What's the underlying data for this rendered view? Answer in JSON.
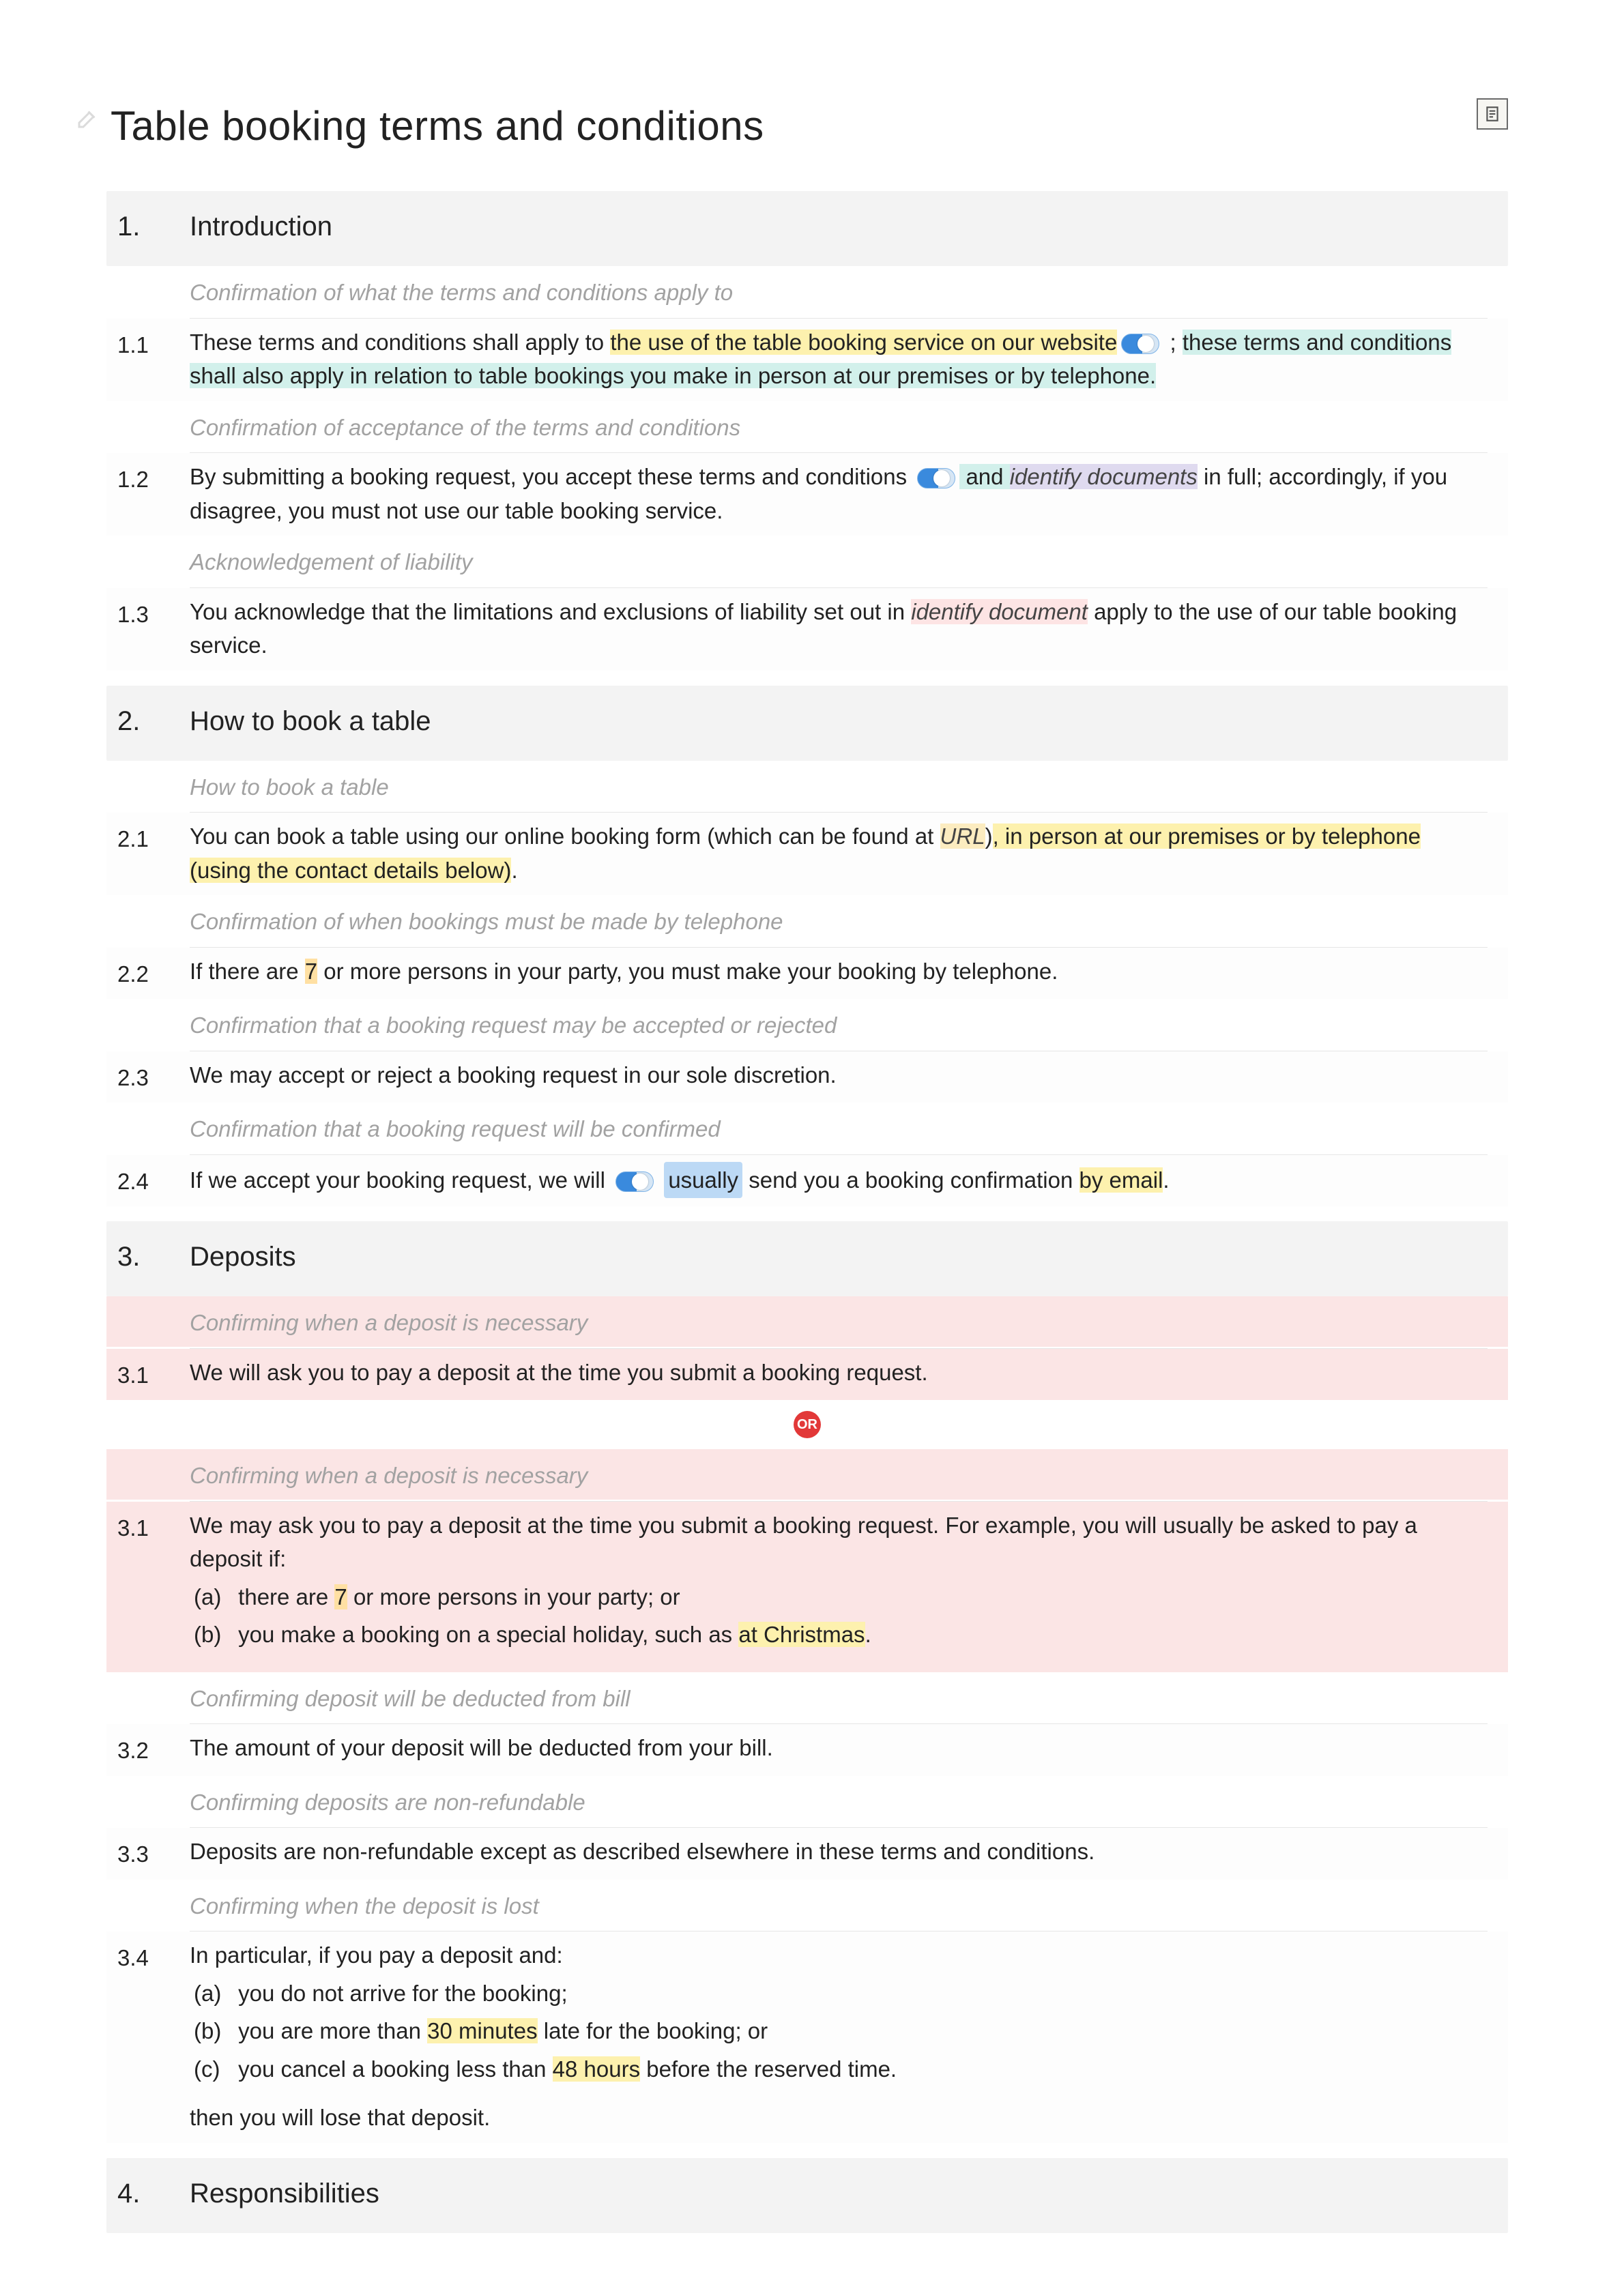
{
  "title": "Table booking terms and conditions",
  "sections": {
    "s1": {
      "num": "1.",
      "title": "Introduction"
    },
    "s2": {
      "num": "2.",
      "title": "How to book a table"
    },
    "s3": {
      "num": "3.",
      "title": "Deposits"
    },
    "s4": {
      "num": "4.",
      "title": "Responsibilities"
    }
  },
  "annots": {
    "a11": "Confirmation of what the terms and conditions apply to",
    "a12": "Confirmation of acceptance of the terms and conditions",
    "a13": "Acknowledgement of liability",
    "a21": "How to book a table",
    "a22": "Confirmation of when bookings must be made by telephone",
    "a23": "Confirmation that a booking request may be accepted or rejected",
    "a24": "Confirmation that a booking request will be confirmed",
    "a31a": "Confirming when a deposit is necessary",
    "a31b": "Confirming when a deposit is necessary",
    "a32": "Confirming deposit will be deducted from bill",
    "a33": "Confirming deposits are non-refundable",
    "a34": "Confirming when the deposit is lost"
  },
  "clauses": {
    "c11": {
      "num": "1.1",
      "pre": "These terms and conditions shall apply to ",
      "hl1": "the use of the table booking service on our website",
      "semi": " ; ",
      "hl2": "these terms and conditions shall also apply in relation to table bookings you make in person at our premises or by telephone."
    },
    "c12": {
      "num": "1.2",
      "pre": "By submitting a booking request, you accept these terms and conditions ",
      "and": " and ",
      "ph": "identify documents",
      "post": " in full; accordingly, if you disagree, you must not use our table booking service."
    },
    "c13": {
      "num": "1.3",
      "pre": "You acknowledge that the limitations and exclusions of liability set out in ",
      "ph": "identify document",
      "post": " apply to the use of our table booking service."
    },
    "c21": {
      "num": "2.1",
      "pre": "You can book a table using our online booking form (which can be found at ",
      "url": "URL",
      "close": ")",
      "hl1": ", in person at our premises or by telephone (using the contact details below)",
      "dot": "."
    },
    "c22": {
      "num": "2.2",
      "pre": "If there are ",
      "n": "7",
      "post": " or more persons in your party, you must make your booking by telephone."
    },
    "c23": {
      "num": "2.3",
      "text": "We may accept or reject a booking request in our sole discretion."
    },
    "c24": {
      "num": "2.4",
      "pre": "If we accept your booking request, we will ",
      "usually": "usually",
      "mid": " send you a booking confirmation ",
      "email": "by email",
      "dot": "."
    },
    "c31a": {
      "num": "3.1",
      "text": "We will ask you to pay a deposit at the time you submit a booking request."
    },
    "c31b": {
      "num": "3.1",
      "lead": "We may ask you to pay a deposit at the time you submit a booking request. For example, you will usually be asked to pay a deposit if:",
      "a_tag": "(a)",
      "a_pre": " there are ",
      "a_n": "7",
      "a_post": " or more persons in your party; or",
      "b_tag": "(b)",
      "b_pre": " you make a booking on a special holiday, such as ",
      "b_hl": "at Christmas",
      "b_dot": "."
    },
    "c32": {
      "num": "3.2",
      "text": "The amount of your deposit will be deducted from your bill."
    },
    "c33": {
      "num": "3.3",
      "text": "Deposits are non-refundable except as described elsewhere in these terms and conditions."
    },
    "c34": {
      "num": "3.4",
      "lead": "In particular, if you pay a deposit and:",
      "a_tag": "(a)",
      "a_text": " you do not arrive for the booking;",
      "b_tag": "(b)",
      "b_pre": " you are more than ",
      "b_hl": "30 minutes",
      "b_post": " late for the booking; or",
      "c_tag": "(c)",
      "c_pre": " you cancel a booking less than ",
      "c_hl": "48 hours",
      "c_post": " before the reserved time.",
      "after": "then you will lose that deposit."
    }
  },
  "or_label": "OR"
}
